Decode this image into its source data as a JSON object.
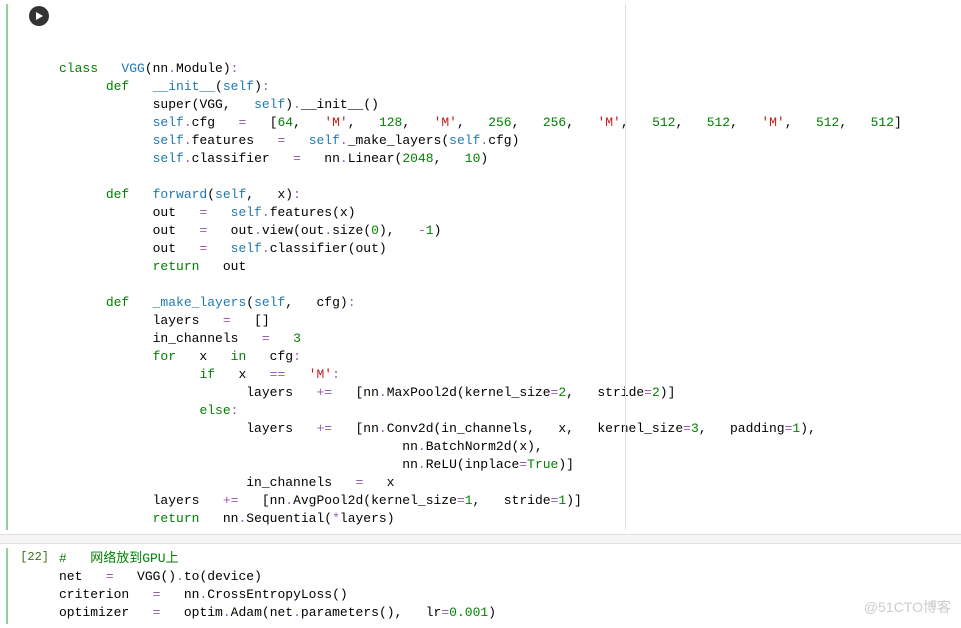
{
  "cell1": {
    "prefix": "",
    "lines": [
      [
        [
          "kw",
          "class"
        ],
        [
          "sp",
          "   "
        ],
        [
          "cls",
          "VGG"
        ],
        [
          "punc",
          "(nn"
        ],
        [
          "op",
          "."
        ],
        [
          "punc",
          "Module)"
        ],
        [
          "op",
          ":"
        ]
      ],
      [
        [
          "sp",
          "      "
        ],
        [
          "kw",
          "def"
        ],
        [
          "sp",
          "   "
        ],
        [
          "fn",
          "__init__"
        ],
        [
          "punc",
          "("
        ],
        [
          "self",
          "self"
        ],
        [
          "punc",
          ")"
        ],
        [
          "op",
          ":"
        ]
      ],
      [
        [
          "sp",
          "            "
        ],
        [
          "ident",
          "super"
        ],
        [
          "punc",
          "("
        ],
        [
          "ident",
          "VGG"
        ],
        [
          "punc",
          ",   "
        ],
        [
          "self",
          "self"
        ],
        [
          "punc",
          ")"
        ],
        [
          "op",
          "."
        ],
        [
          "ident",
          "__init__"
        ],
        [
          "punc",
          "()"
        ]
      ],
      [
        [
          "sp",
          "            "
        ],
        [
          "self",
          "self"
        ],
        [
          "op",
          "."
        ],
        [
          "ident",
          "cfg   "
        ],
        [
          "op",
          "="
        ],
        [
          "sp",
          "   "
        ],
        [
          "punc",
          "["
        ],
        [
          "num",
          "64"
        ],
        [
          "punc",
          ",   "
        ],
        [
          "str",
          "'M'"
        ],
        [
          "punc",
          ",   "
        ],
        [
          "num",
          "128"
        ],
        [
          "punc",
          ",   "
        ],
        [
          "str",
          "'M'"
        ],
        [
          "punc",
          ",   "
        ],
        [
          "num",
          "256"
        ],
        [
          "punc",
          ",   "
        ],
        [
          "num",
          "256"
        ],
        [
          "punc",
          ",   "
        ],
        [
          "str",
          "'M'"
        ],
        [
          "punc",
          ",   "
        ],
        [
          "num",
          "512"
        ],
        [
          "punc",
          ",   "
        ],
        [
          "num",
          "512"
        ],
        [
          "punc",
          ",   "
        ],
        [
          "str",
          "'M'"
        ],
        [
          "punc",
          ",   "
        ],
        [
          "num",
          "512"
        ],
        [
          "punc",
          ",   "
        ],
        [
          "num",
          "512"
        ],
        [
          "punc",
          "]"
        ]
      ],
      [
        [
          "sp",
          "            "
        ],
        [
          "self",
          "self"
        ],
        [
          "op",
          "."
        ],
        [
          "ident",
          "features   "
        ],
        [
          "op",
          "="
        ],
        [
          "sp",
          "   "
        ],
        [
          "self",
          "self"
        ],
        [
          "op",
          "."
        ],
        [
          "ident",
          "_make_layers"
        ],
        [
          "punc",
          "("
        ],
        [
          "self",
          "self"
        ],
        [
          "op",
          "."
        ],
        [
          "ident",
          "cfg"
        ],
        [
          "punc",
          ")"
        ]
      ],
      [
        [
          "sp",
          "            "
        ],
        [
          "self",
          "self"
        ],
        [
          "op",
          "."
        ],
        [
          "ident",
          "classifier   "
        ],
        [
          "op",
          "="
        ],
        [
          "sp",
          "   nn"
        ],
        [
          "op",
          "."
        ],
        [
          "ident",
          "Linear"
        ],
        [
          "punc",
          "("
        ],
        [
          "num",
          "2048"
        ],
        [
          "punc",
          ",   "
        ],
        [
          "num",
          "10"
        ],
        [
          "punc",
          ")"
        ]
      ],
      [
        [
          "sp",
          " "
        ]
      ],
      [
        [
          "sp",
          "      "
        ],
        [
          "kw",
          "def"
        ],
        [
          "sp",
          "   "
        ],
        [
          "fn",
          "forward"
        ],
        [
          "punc",
          "("
        ],
        [
          "self",
          "self"
        ],
        [
          "punc",
          ",   x)"
        ],
        [
          "op",
          ":"
        ]
      ],
      [
        [
          "sp",
          "            "
        ],
        [
          "ident",
          "out   "
        ],
        [
          "op",
          "="
        ],
        [
          "sp",
          "   "
        ],
        [
          "self",
          "self"
        ],
        [
          "op",
          "."
        ],
        [
          "ident",
          "features"
        ],
        [
          "punc",
          "(x)"
        ]
      ],
      [
        [
          "sp",
          "            "
        ],
        [
          "ident",
          "out   "
        ],
        [
          "op",
          "="
        ],
        [
          "sp",
          "   out"
        ],
        [
          "op",
          "."
        ],
        [
          "ident",
          "view"
        ],
        [
          "punc",
          "(out"
        ],
        [
          "op",
          "."
        ],
        [
          "ident",
          "size"
        ],
        [
          "punc",
          "("
        ],
        [
          "num",
          "0"
        ],
        [
          "punc",
          "),   "
        ],
        [
          "op",
          "-"
        ],
        [
          "num",
          "1"
        ],
        [
          "punc",
          ")"
        ]
      ],
      [
        [
          "sp",
          "            "
        ],
        [
          "ident",
          "out   "
        ],
        [
          "op",
          "="
        ],
        [
          "sp",
          "   "
        ],
        [
          "self",
          "self"
        ],
        [
          "op",
          "."
        ],
        [
          "ident",
          "classifier"
        ],
        [
          "punc",
          "(out)"
        ]
      ],
      [
        [
          "sp",
          "            "
        ],
        [
          "kw",
          "return"
        ],
        [
          "sp",
          "   out"
        ]
      ],
      [
        [
          "sp",
          " "
        ]
      ],
      [
        [
          "sp",
          "      "
        ],
        [
          "kw",
          "def"
        ],
        [
          "sp",
          "   "
        ],
        [
          "fn",
          "_make_layers"
        ],
        [
          "punc",
          "("
        ],
        [
          "self",
          "self"
        ],
        [
          "punc",
          ",   cfg)"
        ],
        [
          "op",
          ":"
        ]
      ],
      [
        [
          "sp",
          "            "
        ],
        [
          "ident",
          "layers   "
        ],
        [
          "op",
          "="
        ],
        [
          "sp",
          "   "
        ],
        [
          "punc",
          "[]"
        ]
      ],
      [
        [
          "sp",
          "            "
        ],
        [
          "ident",
          "in_channels   "
        ],
        [
          "op",
          "="
        ],
        [
          "sp",
          "   "
        ],
        [
          "num",
          "3"
        ]
      ],
      [
        [
          "sp",
          "            "
        ],
        [
          "kw",
          "for"
        ],
        [
          "sp",
          "   x   "
        ],
        [
          "kw",
          "in"
        ],
        [
          "sp",
          "   cfg"
        ],
        [
          "op",
          ":"
        ]
      ],
      [
        [
          "sp",
          "                  "
        ],
        [
          "kw",
          "if"
        ],
        [
          "sp",
          "   x   "
        ],
        [
          "op",
          "=="
        ],
        [
          "sp",
          "   "
        ],
        [
          "str",
          "'M'"
        ],
        [
          "op",
          ":"
        ]
      ],
      [
        [
          "sp",
          "                        "
        ],
        [
          "ident",
          "layers   "
        ],
        [
          "op",
          "+="
        ],
        [
          "sp",
          "   "
        ],
        [
          "punc",
          "[nn"
        ],
        [
          "op",
          "."
        ],
        [
          "ident",
          "MaxPool2d"
        ],
        [
          "punc",
          "(kernel_size"
        ],
        [
          "op",
          "="
        ],
        [
          "num",
          "2"
        ],
        [
          "punc",
          ",   stride"
        ],
        [
          "op",
          "="
        ],
        [
          "num",
          "2"
        ],
        [
          "punc",
          ")]"
        ]
      ],
      [
        [
          "sp",
          "                  "
        ],
        [
          "kw",
          "else"
        ],
        [
          "op",
          ":"
        ]
      ],
      [
        [
          "sp",
          "                        "
        ],
        [
          "ident",
          "layers   "
        ],
        [
          "op",
          "+="
        ],
        [
          "sp",
          "   "
        ],
        [
          "punc",
          "[nn"
        ],
        [
          "op",
          "."
        ],
        [
          "ident",
          "Conv2d"
        ],
        [
          "punc",
          "(in_channels,   x,   kernel_size"
        ],
        [
          "op",
          "="
        ],
        [
          "num",
          "3"
        ],
        [
          "punc",
          ",   padding"
        ],
        [
          "op",
          "="
        ],
        [
          "num",
          "1"
        ],
        [
          "punc",
          "),"
        ]
      ],
      [
        [
          "sp",
          "                                            "
        ],
        [
          "ident",
          "nn"
        ],
        [
          "op",
          "."
        ],
        [
          "ident",
          "BatchNorm2d"
        ],
        [
          "punc",
          "(x),"
        ]
      ],
      [
        [
          "sp",
          "                                            "
        ],
        [
          "ident",
          "nn"
        ],
        [
          "op",
          "."
        ],
        [
          "ident",
          "ReLU"
        ],
        [
          "punc",
          "(inplace"
        ],
        [
          "op",
          "="
        ],
        [
          "bool",
          "True"
        ],
        [
          "punc",
          ")]"
        ]
      ],
      [
        [
          "sp",
          "                        "
        ],
        [
          "ident",
          "in_channels   "
        ],
        [
          "op",
          "="
        ],
        [
          "sp",
          "   x"
        ]
      ],
      [
        [
          "sp",
          "            "
        ],
        [
          "ident",
          "layers   "
        ],
        [
          "op",
          "+="
        ],
        [
          "sp",
          "   "
        ],
        [
          "punc",
          "[nn"
        ],
        [
          "op",
          "."
        ],
        [
          "ident",
          "AvgPool2d"
        ],
        [
          "punc",
          "(kernel_size"
        ],
        [
          "op",
          "="
        ],
        [
          "num",
          "1"
        ],
        [
          "punc",
          ",   stride"
        ],
        [
          "op",
          "="
        ],
        [
          "num",
          "1"
        ],
        [
          "punc",
          ")]"
        ]
      ],
      [
        [
          "sp",
          "            "
        ],
        [
          "kw",
          "return"
        ],
        [
          "sp",
          "   nn"
        ],
        [
          "op",
          "."
        ],
        [
          "ident",
          "Sequential"
        ],
        [
          "punc",
          "("
        ],
        [
          "op",
          "*"
        ],
        [
          "ident",
          "layers"
        ],
        [
          "punc",
          ")"
        ]
      ]
    ]
  },
  "cell2": {
    "prefix": "[22]",
    "lines": [
      [
        [
          "cmt",
          "#   网络放到GPU上"
        ]
      ],
      [
        [
          "ident",
          "net   "
        ],
        [
          "op",
          "="
        ],
        [
          "sp",
          "   "
        ],
        [
          "ident",
          "VGG"
        ],
        [
          "punc",
          "()"
        ],
        [
          "op",
          "."
        ],
        [
          "ident",
          "to"
        ],
        [
          "punc",
          "(device)"
        ]
      ],
      [
        [
          "ident",
          "criterion   "
        ],
        [
          "op",
          "="
        ],
        [
          "sp",
          "   nn"
        ],
        [
          "op",
          "."
        ],
        [
          "ident",
          "CrossEntropyLoss"
        ],
        [
          "punc",
          "()"
        ]
      ],
      [
        [
          "ident",
          "optimizer   "
        ],
        [
          "op",
          "="
        ],
        [
          "sp",
          "   optim"
        ],
        [
          "op",
          "."
        ],
        [
          "ident",
          "Adam"
        ],
        [
          "punc",
          "(net"
        ],
        [
          "op",
          "."
        ],
        [
          "ident",
          "parameters"
        ],
        [
          "punc",
          "(),   lr"
        ],
        [
          "op",
          "="
        ],
        [
          "num",
          "0.001"
        ],
        [
          "punc",
          ")"
        ]
      ]
    ]
  },
  "watermark": "@51CTO博客"
}
